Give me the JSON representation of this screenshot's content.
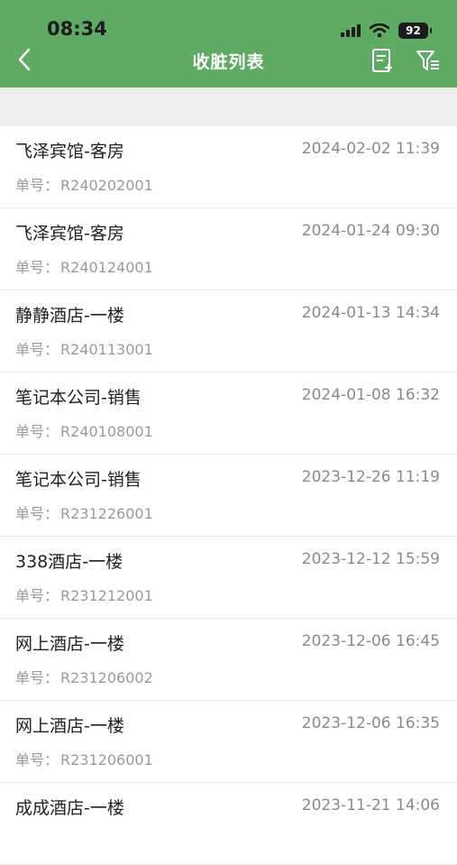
{
  "status_bar": {
    "time": "08:34",
    "battery": "92"
  },
  "nav": {
    "title": "收脏列表"
  },
  "order_label": "单号：",
  "items": [
    {
      "name": "飞泽宾馆-客房",
      "time": "2024-02-02 11:39",
      "order_no": "R240202001"
    },
    {
      "name": "飞泽宾馆-客房",
      "time": "2024-01-24 09:30",
      "order_no": "R240124001"
    },
    {
      "name": "静静酒店-一楼",
      "time": "2024-01-13 14:34",
      "order_no": "R240113001"
    },
    {
      "name": "笔记本公司-销售",
      "time": "2024-01-08 16:32",
      "order_no": "R240108001"
    },
    {
      "name": "笔记本公司-销售",
      "time": "2023-12-26 11:19",
      "order_no": "R231226001"
    },
    {
      "name": "338酒店-一楼",
      "time": "2023-12-12 15:59",
      "order_no": "R231212001"
    },
    {
      "name": "网上酒店-一楼",
      "time": "2023-12-06 16:45",
      "order_no": "R231206002"
    },
    {
      "name": "网上酒店-一楼",
      "time": "2023-12-06 16:35",
      "order_no": "R231206001"
    },
    {
      "name": "成成酒店-一楼",
      "time": "2023-11-21 14:06",
      "order_no": ""
    }
  ],
  "colors": {
    "header": "#5fab64",
    "background": "#efefef"
  },
  "icons": [
    "back-chevron-icon",
    "add-document-icon",
    "filter-icon"
  ]
}
